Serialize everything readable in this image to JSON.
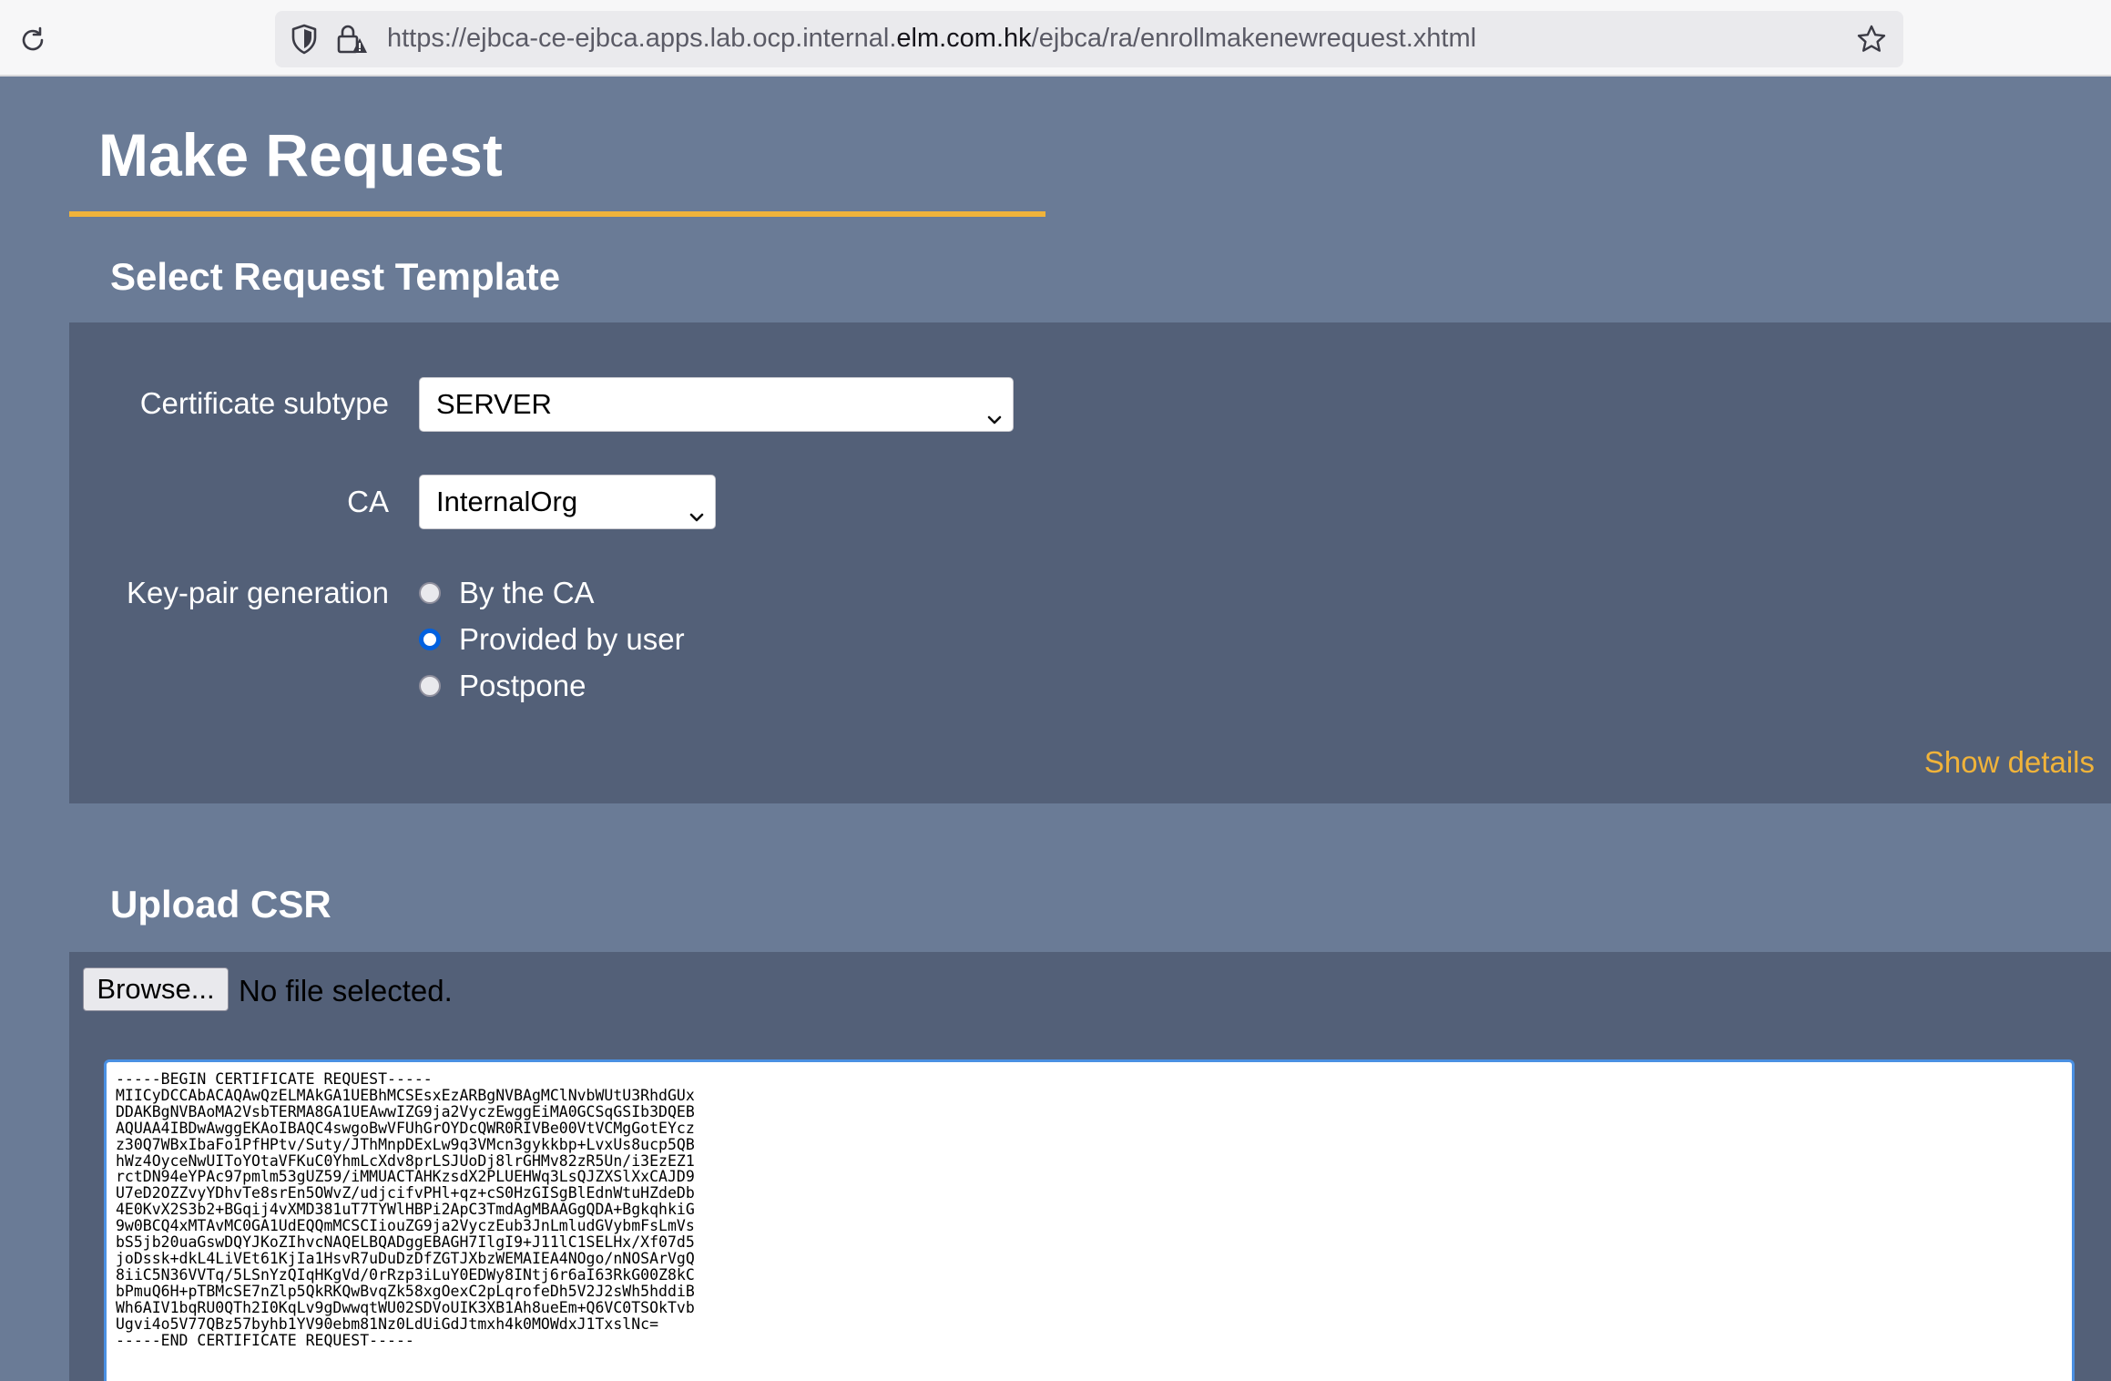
{
  "browser": {
    "url_prefix": "https://ejbca-ce-ejbca.apps.lab.ocp.internal.",
    "url_domain": "elm.com.hk",
    "url_suffix": "/ejbca/ra/enrollmakenewrequest.xhtml"
  },
  "page": {
    "title": "Make Request"
  },
  "template_section": {
    "title": "Select Request Template",
    "certificate_subtype_label": "Certificate subtype",
    "certificate_subtype_value": "SERVER",
    "ca_label": "CA",
    "ca_value": "InternalOrg",
    "keypair_label": "Key-pair generation",
    "keypair_options": [
      {
        "label": "By the CA",
        "selected": false
      },
      {
        "label": "Provided by user",
        "selected": true
      },
      {
        "label": "Postpone",
        "selected": false
      }
    ],
    "show_details": "Show details"
  },
  "upload_section": {
    "title": "Upload CSR",
    "browse_label": "Browse...",
    "file_status": "No file selected.",
    "csr_text": "-----BEGIN CERTIFICATE REQUEST-----\nMIICyDCCAbACAQAwQzELMAkGA1UEBhMCSEsxEzARBgNVBAgMClNvbWUtU3RhdGUx\nDDAKBgNVBAoMA2VsbTERMA8GA1UEAwwIZG9ja2VyczEwggEiMA0GCSqGSIb3DQEB\nAQUAA4IBDwAwggEKAoIBAQC4swgoBwVFUhGrOYDcQWR0RIVBe00VtVCMgGotEYcz\nz30Q7WBxIbaFo1PfHPtv/Suty/JThMnpDExLw9q3VMcn3gykkbp+LvxUs8ucp5QB\nhWz4OyceNwUIToYOtaVFKuC0YhmLcXdv8prLSJUoDj8lrGHMv82zR5Un/i3EzEZ1\nrctDN94eYPAc97pmlm53gUZ59/iMMUACTAHKzsdX2PLUEHWq3LsQJZXSlXxCAJD9\nU7eD2OZZvyYDhvTe8srEn5OWvZ/udjcifvPHl+qz+cS0HzGISgBlEdnWtuHZdeDb\n4E0KvX2S3b2+BGqij4vXMD381uT7TYWlHBPi2ApC3TmdAgMBAAGgQDA+BgkqhkiG\n9w0BCQ4xMTAvMC0GA1UdEQQmMCSCIiouZG9ja2VyczEub3JnLmludGVybmFsLmVs\nbS5jb20uaGswDQYJKoZIhvcNAQELBQADggEBAGH7IlgI9+J11lC1SELHx/Xf07d5\njoDssk+dkL4LiVEt61KjIa1HsvR7uDuDzDfZGTJXbzWEMAIEA4NOgo/nNOSArVgQ\n8iiC5N36VVTq/5LSnYzQIqHKgVd/0rRzp3iLuY0EDWy8INtj6r6aI63RkG00Z8kC\nbPmuQ6H+pTBMcSE7nZlp5QkRKQwBvqZk58xgOexC2pLqrofeDh5V2J2sWh5hddiB\nWh6AIV1bqRU0QTh2I0KqLv9gDwwqtWU02SDVoUIK3XB1Ah8ueEm+Q6VC0TSOkTvb\nUgvi4o5V77QBz57byhb1YV90ebm81Nz0LdUiGdJtmxh4k0MOWdxJ1TxslNc=\n-----END CERTIFICATE REQUEST-----"
  },
  "icons": {
    "reload": "reload-icon",
    "shield": "shield-icon",
    "lock": "lock-warning-icon",
    "star": "bookmark-star-icon",
    "chevron": "chevron-down-icon"
  },
  "colors": {
    "page_bg": "#6a7b96",
    "panel_bg": "#536078",
    "accent": "#f0b33a",
    "radio_selected": "#0060df"
  }
}
